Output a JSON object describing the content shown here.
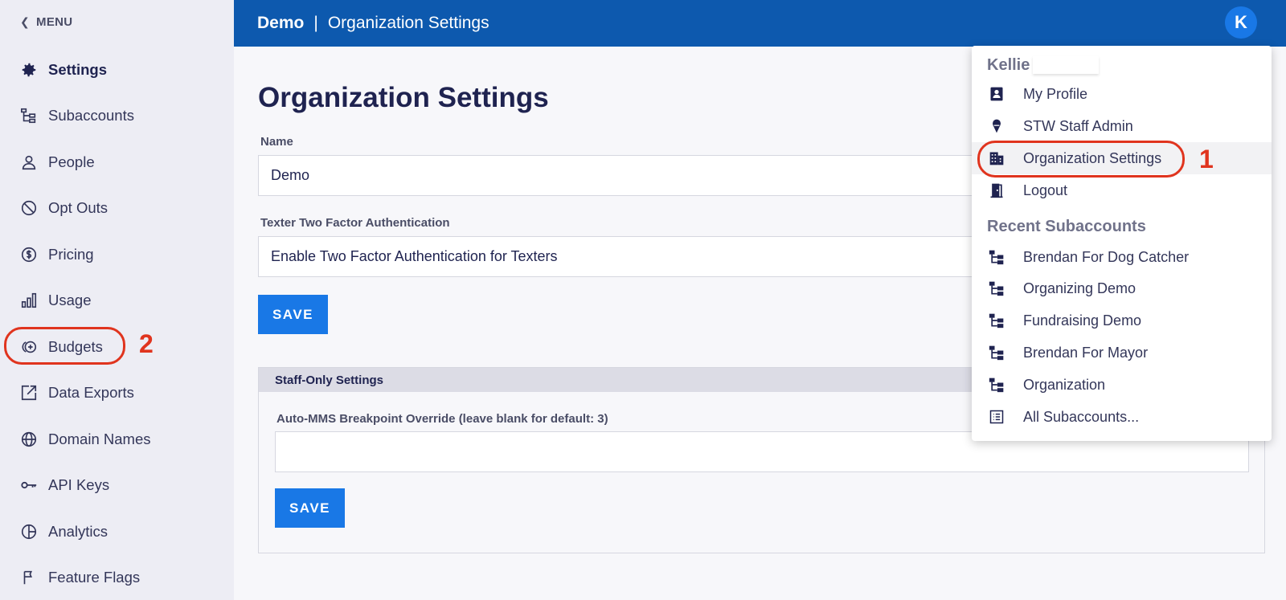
{
  "sidebar": {
    "menu_label": "MENU",
    "items": [
      {
        "label": "Settings",
        "icon": "gear-icon"
      },
      {
        "label": "Subaccounts",
        "icon": "hierarchy-icon"
      },
      {
        "label": "People",
        "icon": "person-icon"
      },
      {
        "label": "Opt Outs",
        "icon": "block-icon"
      },
      {
        "label": "Pricing",
        "icon": "dollar-circle-icon"
      },
      {
        "label": "Usage",
        "icon": "bar-chart-icon"
      },
      {
        "label": "Budgets",
        "icon": "budget-coin-icon"
      },
      {
        "label": "Data Exports",
        "icon": "export-icon"
      },
      {
        "label": "Domain Names",
        "icon": "globe-icon"
      },
      {
        "label": "API Keys",
        "icon": "key-icon"
      },
      {
        "label": "Analytics",
        "icon": "pie-chart-icon"
      },
      {
        "label": "Feature Flags",
        "icon": "flag-icon"
      }
    ]
  },
  "header": {
    "org": "Demo",
    "separator": "|",
    "title": "Organization Settings",
    "avatar_initial": "K"
  },
  "main": {
    "title": "Organization Settings",
    "name_label": "Name",
    "name_value": "Demo",
    "tfa_label": "Texter Two Factor Authentication",
    "tfa_value": "Enable Two Factor Authentication for Texters",
    "save_label": "SAVE",
    "staff": {
      "heading": "Staff-Only Settings",
      "mms_label": "Auto-MMS Breakpoint Override (leave blank for default: 3)",
      "mms_value": "",
      "save_label": "SAVE"
    }
  },
  "dropdown": {
    "user_name": "Kellie",
    "items": [
      {
        "label": "My Profile",
        "icon": "profile-card-icon"
      },
      {
        "label": "STW Staff Admin",
        "icon": "ice-cream-icon"
      },
      {
        "label": "Organization Settings",
        "icon": "building-icon"
      },
      {
        "label": "Logout",
        "icon": "door-icon"
      }
    ],
    "recent_heading": "Recent Subaccounts",
    "recent": [
      {
        "label": "Brendan For Dog Catcher"
      },
      {
        "label": "Organizing Demo"
      },
      {
        "label": "Fundraising Demo"
      },
      {
        "label": "Brendan For Mayor"
      },
      {
        "label": "Organization"
      }
    ],
    "all_label": "All Subaccounts..."
  },
  "annotations": {
    "one": "1",
    "two": "2",
    "color": "#e0341e"
  },
  "colors": {
    "header_bg": "#0d59ae",
    "accent": "#1978e6",
    "sidebar_bg": "#ededf4",
    "text_dark": "#1f2350"
  }
}
